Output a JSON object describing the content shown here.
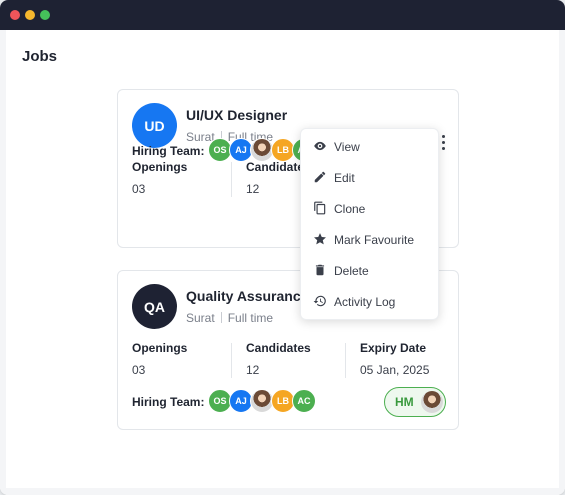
{
  "page": {
    "title": "Jobs"
  },
  "jobs": [
    {
      "initials": "UD",
      "logo_color": "#1677f2",
      "title": "UI/UX Designer",
      "location": "Surat",
      "type": "Full time",
      "openings_label": "Openings",
      "openings_value": "03",
      "candidates_label": "Candidates",
      "candidates_value": "12",
      "hiring_label": "Hiring Team:",
      "team": [
        "OS",
        "AJ",
        "",
        "LB",
        "AC"
      ],
      "favourite": true
    },
    {
      "initials": "QA",
      "logo_color": "#1e2233",
      "title": "Quality Assurance",
      "location": "Surat",
      "type": "Full time",
      "openings_label": "Openings",
      "openings_value": "03",
      "candidates_label": "Candidates",
      "candidates_value": "12",
      "expiry_label": "Expiry Date",
      "expiry_value": "05 Jan, 2025",
      "hiring_label": "Hiring Team:",
      "team": [
        "OS",
        "AJ",
        "",
        "LB",
        "AC"
      ],
      "manager_initials": "HM"
    }
  ],
  "menu": {
    "items": [
      {
        "label": "View",
        "icon": "eye-icon"
      },
      {
        "label": "Edit",
        "icon": "pencil-icon"
      },
      {
        "label": "Clone",
        "icon": "copy-icon"
      },
      {
        "label": "Mark Favourite",
        "icon": "star-icon"
      },
      {
        "label": "Delete",
        "icon": "trash-icon"
      },
      {
        "label": "Activity Log",
        "icon": "history-icon"
      }
    ]
  },
  "colors": {
    "accent_blue": "#1677f2",
    "navy": "#1e2233",
    "green": "#4caf50",
    "orange": "#f5a623",
    "star": "#f5a623"
  }
}
